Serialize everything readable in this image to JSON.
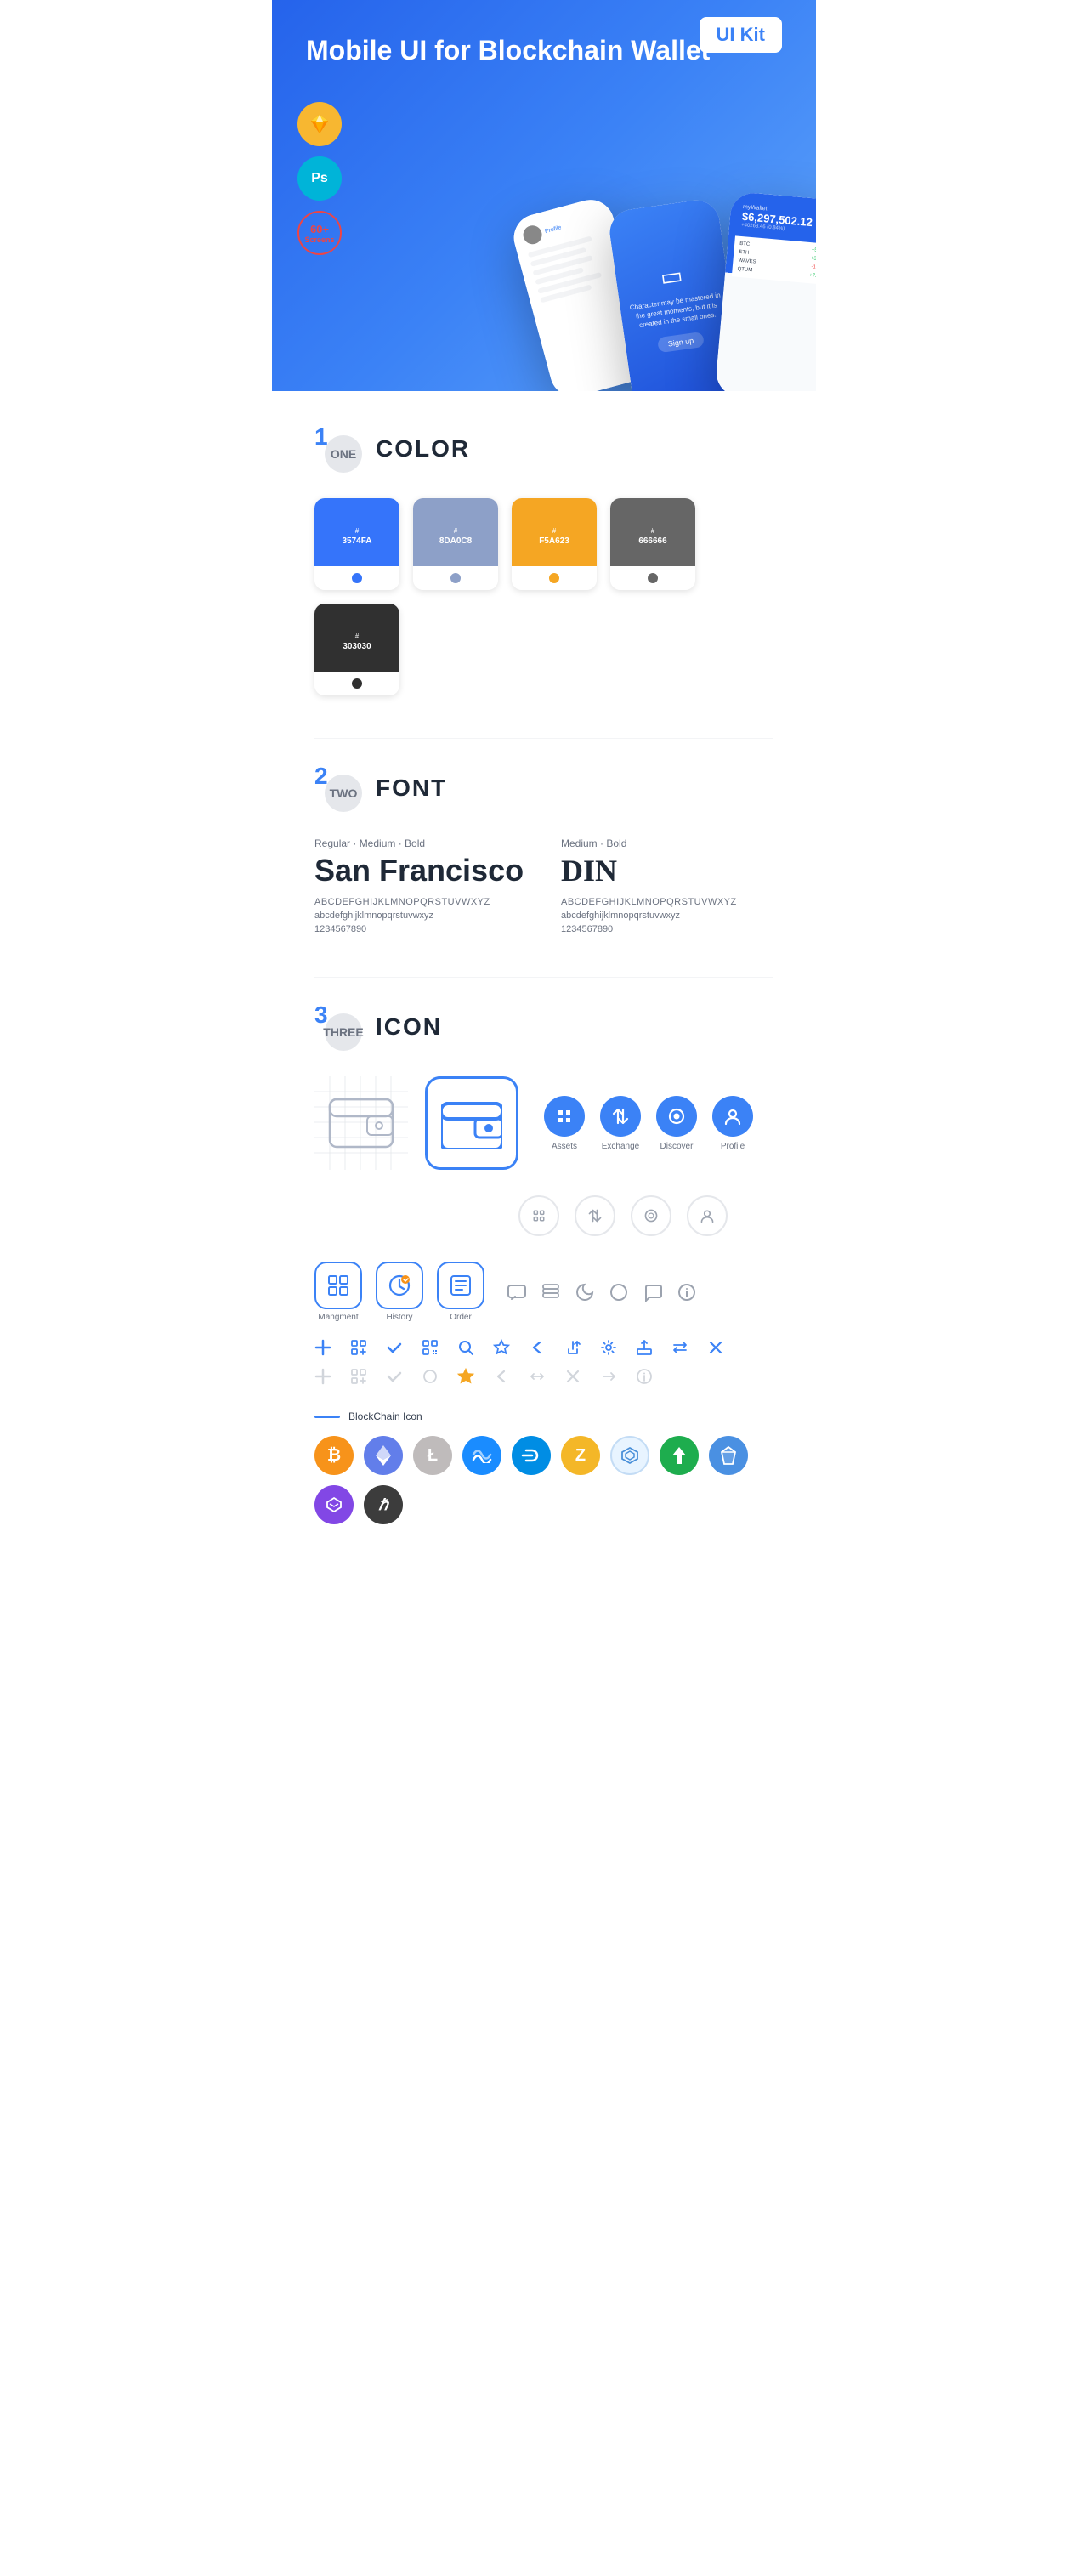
{
  "hero": {
    "title_regular": "Mobile UI for Blockchain ",
    "title_bold": "Wallet",
    "ui_kit_badge": "UI Kit",
    "badges": [
      {
        "id": "sketch",
        "label": "Sketch",
        "symbol": "◇"
      },
      {
        "id": "ps",
        "label": "Ps"
      },
      {
        "id": "screens",
        "count": "60+",
        "label": "Screens"
      }
    ]
  },
  "sections": {
    "color": {
      "number": "1",
      "number_label": "ONE",
      "title": "COLOR",
      "swatches": [
        {
          "id": "blue",
          "hex": "#3574FA",
          "label": "#3574FA",
          "dot_color": "#2563eb"
        },
        {
          "id": "grey_blue",
          "hex": "#8DA0C8",
          "label": "#8DA0C8",
          "dot_color": "#8DA0C8"
        },
        {
          "id": "orange",
          "hex": "#F5A623",
          "label": "#F5A623",
          "dot_color": "#e5950f"
        },
        {
          "id": "grey",
          "hex": "#666666",
          "label": "#666666",
          "dot_color": "#555"
        },
        {
          "id": "dark",
          "hex": "#303030",
          "label": "#303030",
          "dot_color": "#222"
        }
      ]
    },
    "font": {
      "number": "2",
      "number_label": "TWO",
      "title": "FONT",
      "fonts": [
        {
          "id": "san_francisco",
          "weights": "Regular · Medium · Bold",
          "name": "San Francisco",
          "uppercase": "ABCDEFGHIJKLMNOPQRSTUVWXYZ",
          "lowercase": "abcdefghijklmnopqrstuvwxyz",
          "numbers": "1234567890"
        },
        {
          "id": "din",
          "weights": "Medium · Bold",
          "name": "DIN",
          "uppercase": "ABCDEFGHIJKLMNOPQRSTUVWXYZ",
          "lowercase": "abcdefghijklmnopqrstuvwxyz",
          "numbers": "1234567890"
        }
      ]
    },
    "icon": {
      "number": "3",
      "number_label": "THREE",
      "title": "ICON",
      "nav_icons": [
        {
          "label": "Assets",
          "symbol": "◈",
          "colored": true
        },
        {
          "label": "Exchange",
          "symbol": "⇄",
          "colored": true
        },
        {
          "label": "Discover",
          "symbol": "◉",
          "colored": true
        },
        {
          "label": "Profile",
          "symbol": "◑",
          "colored": true
        }
      ],
      "nav_icons_outline": [
        {
          "symbol": "◈"
        },
        {
          "symbol": "⇄"
        },
        {
          "symbol": "◉"
        },
        {
          "symbol": "◑"
        }
      ],
      "app_icons": [
        {
          "label": "Mangment",
          "symbol": "▣"
        },
        {
          "label": "History",
          "symbol": "⊙"
        },
        {
          "label": "Order",
          "symbol": "≡"
        }
      ],
      "tool_icons_colored": [
        "+",
        "⊞",
        "✓",
        "⊟",
        "🔍",
        "☆",
        "‹",
        "≪",
        "⚙",
        "⊡",
        "⇔",
        "✕"
      ],
      "tool_icons_grey": [
        "+",
        "⊞",
        "✓",
        "⊟",
        "◎",
        "☆",
        "‹",
        "↔",
        "✕",
        "→",
        "ℹ"
      ],
      "blockchain_label": "BlockChain Icon",
      "crypto_coins": [
        {
          "id": "btc",
          "symbol": "₿",
          "bg": "#f7931a",
          "color": "#fff"
        },
        {
          "id": "eth",
          "symbol": "Ξ",
          "bg": "#627eea",
          "color": "#fff"
        },
        {
          "id": "ltc",
          "symbol": "Ł",
          "bg": "#bfbbbb",
          "color": "#fff"
        },
        {
          "id": "waves",
          "symbol": "≋",
          "bg": "#1a8cff",
          "color": "#fff"
        },
        {
          "id": "dash",
          "symbol": "D",
          "bg": "#008de4",
          "color": "#fff"
        },
        {
          "id": "zcash",
          "symbol": "Z",
          "bg": "#f4b728",
          "color": "#fff"
        },
        {
          "id": "grid",
          "symbol": "⬡",
          "bg": "#e8f4ff",
          "color": "#4a90d9"
        },
        {
          "id": "siacoin",
          "symbol": "▲",
          "bg": "#1ead4e",
          "color": "#fff"
        },
        {
          "id": "nano",
          "symbol": "◆",
          "bg": "#4a90e2",
          "color": "#fff"
        },
        {
          "id": "matic",
          "symbol": "◈",
          "bg": "#8247e5",
          "color": "#fff"
        },
        {
          "id": "hbar",
          "symbol": "ℏ",
          "bg": "#3c3c3c",
          "color": "#fff"
        }
      ]
    }
  }
}
